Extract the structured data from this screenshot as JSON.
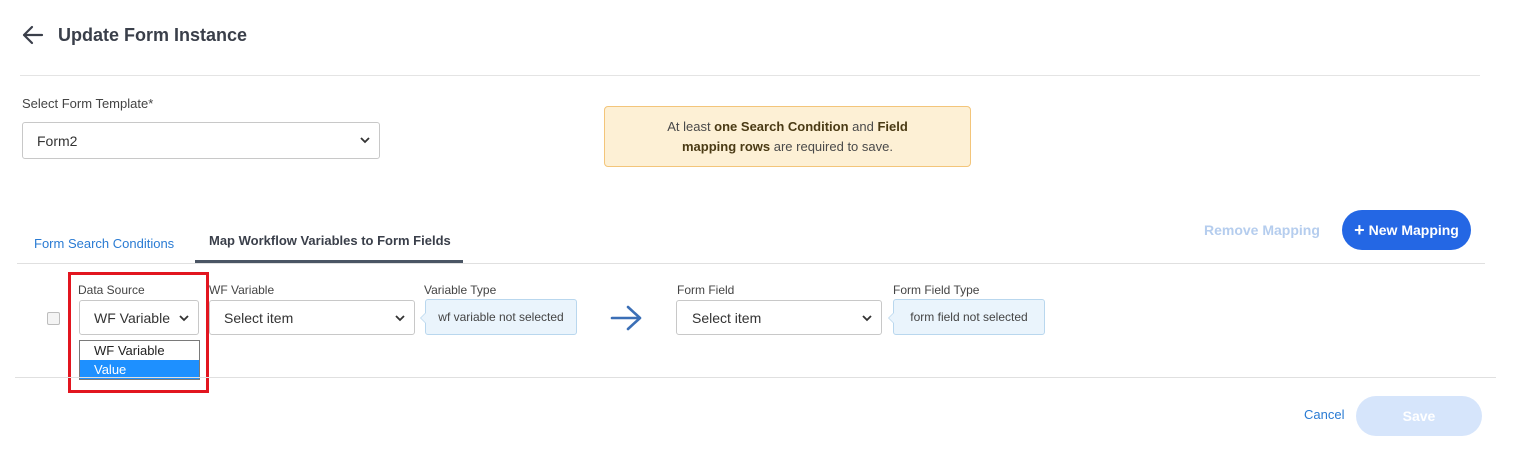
{
  "header": {
    "title": "Update Form Instance"
  },
  "template": {
    "label": "Select Form Template*",
    "value": "Form2"
  },
  "notice": {
    "text_1": "At least ",
    "bold_1": "one Search Condition",
    "text_2": " and ",
    "bold_2": "Field mapping rows",
    "text_3": " are required to save."
  },
  "tabs": [
    {
      "label": "Form Search Conditions",
      "active": false
    },
    {
      "label": "Map Workflow Variables to Form Fields",
      "active": true
    }
  ],
  "actions": {
    "remove_mapping": "Remove Mapping",
    "new_mapping": "New Mapping"
  },
  "mapping_row": {
    "data_source": {
      "label": "Data Source",
      "value": "WF Variable",
      "options": [
        "WF Variable",
        "Value"
      ],
      "highlighted_option": "Value"
    },
    "wf_variable": {
      "label": "WF Variable",
      "value": "Select item"
    },
    "variable_type": {
      "label": "Variable Type",
      "value": "wf variable not selected"
    },
    "form_field": {
      "label": "Form Field",
      "value": "Select item"
    },
    "form_field_type": {
      "label": "Form Field Type",
      "value": "form field not selected"
    }
  },
  "footer": {
    "cancel": "Cancel",
    "save": "Save"
  },
  "colors": {
    "primary": "#2467e4",
    "link": "#2a7bd3",
    "highlight": "#e2151f",
    "notice_bg": "#fdf0d5",
    "type_bg": "#eaf4fc"
  },
  "icons": {
    "back": "arrow-left-icon",
    "chevron": "chevron-down-icon",
    "map_arrow": "arrow-right-icon",
    "plus": "plus-icon"
  }
}
